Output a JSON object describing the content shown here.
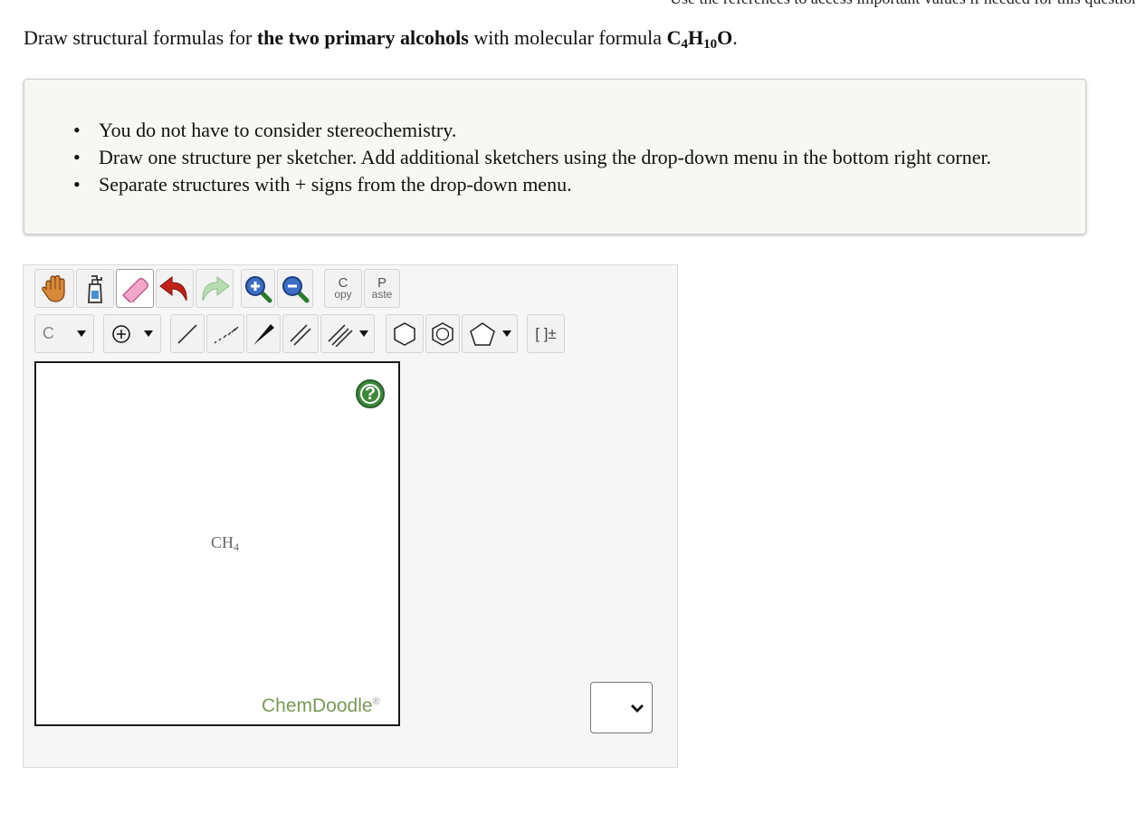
{
  "question": {
    "prefix": "Draw structural formulas for ",
    "bold": "the two primary alcohols",
    "middle": " with molecular formula ",
    "formula": {
      "c": "C",
      "c_sub": "4",
      "h": "H",
      "h_sub": "10",
      "o": "O"
    },
    "suffix": "."
  },
  "instructions": [
    "You do not have to consider stereochemistry.",
    "Draw one structure per sketcher. Add additional sketchers using the drop-down menu in the bottom right corner.",
    "Separate structures with + signs from the drop-down menu."
  ],
  "toolbar": {
    "copy": {
      "top": "C",
      "bottom": "opy"
    },
    "paste": {
      "top": "P",
      "bottom": "aste"
    },
    "atom_label": "C",
    "bracket_label": "[ ]±"
  },
  "canvas": {
    "molecule": {
      "base": "CH",
      "sub": "4"
    },
    "help": "?",
    "brand": "ChemDoodle",
    "brand_mark": "®"
  },
  "colors": {
    "brand": "#7a9a59",
    "help": "#3c8a3c",
    "panel": "#f7f8f3"
  }
}
